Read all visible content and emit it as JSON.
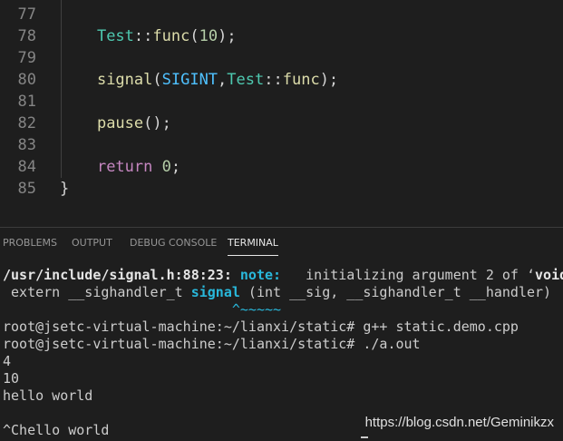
{
  "editor": {
    "lines": [
      {
        "num": "77",
        "tokens": []
      },
      {
        "num": "78",
        "tokens": [
          {
            "text": "    ",
            "cls": "tok-punct"
          },
          {
            "text": "Test",
            "cls": "tok-type"
          },
          {
            "text": "::",
            "cls": "tok-punct"
          },
          {
            "text": "func",
            "cls": "tok-fn"
          },
          {
            "text": "(",
            "cls": "tok-punct"
          },
          {
            "text": "10",
            "cls": "tok-num"
          },
          {
            "text": ");",
            "cls": "tok-punct"
          }
        ]
      },
      {
        "num": "79",
        "tokens": []
      },
      {
        "num": "80",
        "tokens": [
          {
            "text": "    ",
            "cls": "tok-punct"
          },
          {
            "text": "signal",
            "cls": "tok-fn"
          },
          {
            "text": "(",
            "cls": "tok-punct"
          },
          {
            "text": "SIGINT",
            "cls": "tok-const"
          },
          {
            "text": ",",
            "cls": "tok-punct"
          },
          {
            "text": "Test",
            "cls": "tok-type"
          },
          {
            "text": "::",
            "cls": "tok-punct"
          },
          {
            "text": "func",
            "cls": "tok-fn"
          },
          {
            "text": ");",
            "cls": "tok-punct"
          }
        ]
      },
      {
        "num": "81",
        "tokens": []
      },
      {
        "num": "82",
        "tokens": [
          {
            "text": "    ",
            "cls": "tok-punct"
          },
          {
            "text": "pause",
            "cls": "tok-fn"
          },
          {
            "text": "();",
            "cls": "tok-punct"
          }
        ]
      },
      {
        "num": "83",
        "tokens": []
      },
      {
        "num": "84",
        "tokens": [
          {
            "text": "    ",
            "cls": "tok-punct"
          },
          {
            "text": "return",
            "cls": "tok-kw"
          },
          {
            "text": " ",
            "cls": "tok-punct"
          },
          {
            "text": "0",
            "cls": "tok-num"
          },
          {
            "text": ";",
            "cls": "tok-punct"
          }
        ]
      },
      {
        "num": "85",
        "tokens": [
          {
            "text": "}",
            "cls": "tok-punct"
          }
        ]
      }
    ]
  },
  "panel": {
    "tabs": [
      {
        "label": "PROBLEMS",
        "active": false
      },
      {
        "label": "OUTPUT",
        "active": false
      },
      {
        "label": "DEBUG CONSOLE",
        "active": false
      },
      {
        "label": "TERMINAL",
        "active": true
      }
    ]
  },
  "terminal": {
    "lines": [
      [
        {
          "text": "/usr/include/signal.h:88:23: ",
          "cls": "t-bold"
        },
        {
          "text": "note:",
          "cls": "t-note"
        },
        {
          "text": "   initializing argument 2 of ‘",
          "cls": ""
        },
        {
          "text": "void",
          "cls": "t-bold"
        }
      ],
      [
        {
          "text": " extern __sighandler_t ",
          "cls": ""
        },
        {
          "text": "signal",
          "cls": "t-hl"
        },
        {
          "text": " (int __sig, __sighandler_t __handler)",
          "cls": ""
        }
      ],
      [
        {
          "text": "                            ^~~~~~",
          "cls": "t-caret"
        }
      ],
      [
        {
          "text": "root@jsetc-virtual-machine:~/lianxi/static# g++ static.demo.cpp",
          "cls": ""
        }
      ],
      [
        {
          "text": "root@jsetc-virtual-machine:~/lianxi/static# ./a.out",
          "cls": ""
        }
      ],
      [
        {
          "text": "4",
          "cls": ""
        }
      ],
      [
        {
          "text": "10",
          "cls": ""
        }
      ],
      [
        {
          "text": "hello world",
          "cls": ""
        }
      ],
      [],
      [
        {
          "text": "^Chello world",
          "cls": ""
        }
      ]
    ]
  },
  "watermark": "https://blog.csdn.net/Geminikzx",
  "colors": {
    "background": "#1e1e1e",
    "line_number": "#858585",
    "function": "#dcdcaa",
    "type": "#4ec9b0",
    "number": "#b5cea8",
    "constant": "#4fc1ff",
    "keyword": "#c586c0",
    "terminal_text": "#cccccc",
    "terminal_highlight": "#29b8db"
  }
}
